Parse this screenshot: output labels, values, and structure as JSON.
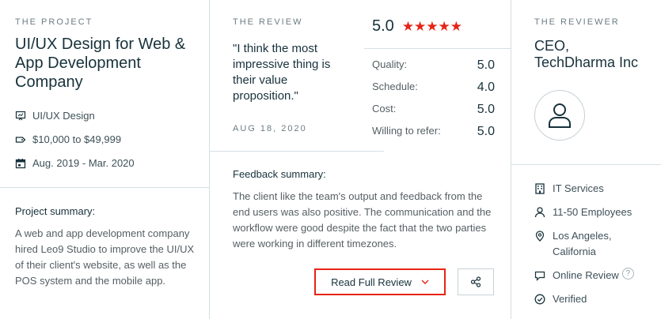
{
  "project": {
    "eyebrow": "THE PROJECT",
    "title": "UI/UX Design for Web & App Development Company",
    "service": "UI/UX Design",
    "budget": "$10,000 to $49,999",
    "dates": "Aug. 2019 - Mar. 2020",
    "summary_title": "Project summary:",
    "summary_text": "A web and app development company hired Leo9 Studio to improve the UI/UX of their client's website, as well as the POS system and the mobile app."
  },
  "review": {
    "eyebrow": "THE REVIEW",
    "quote": "\"I think the most impressive thing is their value proposition.\"",
    "date": "AUG 18, 2020",
    "overall": "5.0",
    "stars": "★★★★★",
    "scores": [
      {
        "label": "Quality:",
        "value": "5.0"
      },
      {
        "label": "Schedule:",
        "value": "4.0"
      },
      {
        "label": "Cost:",
        "value": "5.0"
      },
      {
        "label": "Willing to refer:",
        "value": "5.0"
      }
    ],
    "feedback_title": "Feedback summary:",
    "feedback_text": "The client like the team's output and feedback from the end users was also positive. The communication and the workflow were good despite the fact that the two parties were working in different timezones.",
    "read_button": "Read Full Review"
  },
  "reviewer": {
    "eyebrow": "THE REVIEWER",
    "title": "CEO, TechDharma Inc",
    "industry": "IT Services",
    "size": "11-50 Employees",
    "location": "Los Angeles, California",
    "review_type": "Online Review",
    "help": "?",
    "verified": "Verified"
  },
  "colors": {
    "accent": "#e62415",
    "text": "#17313b",
    "muted": "#555f63",
    "divider": "#d6dfe3"
  }
}
